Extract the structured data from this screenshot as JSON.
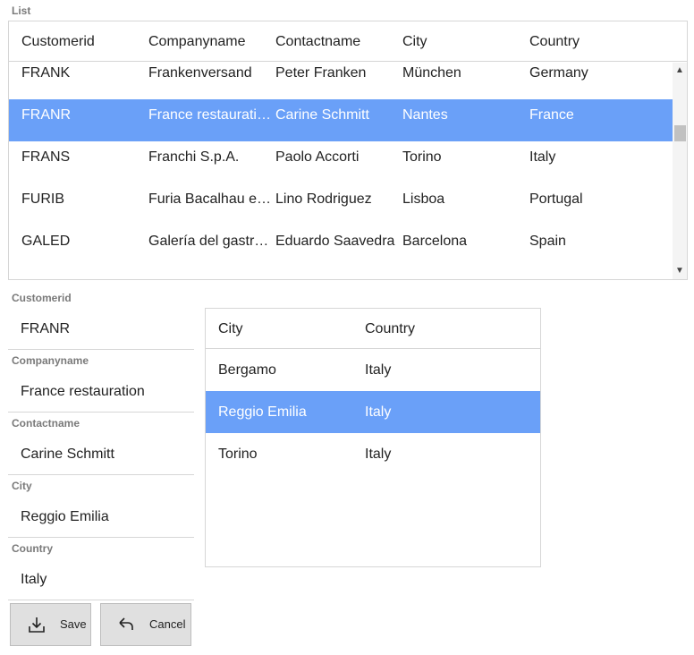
{
  "list": {
    "label": "List",
    "columns": [
      "Customerid",
      "Companyname",
      "Contactname",
      "City",
      "Country"
    ],
    "rows": [
      [
        "FRANK",
        "Frankenversand",
        "Peter Franken",
        "München",
        "Germany"
      ],
      [
        "FRANR",
        "France restauration",
        "Carine Schmitt",
        "Nantes",
        "France"
      ],
      [
        "FRANS",
        "Franchi S.p.A.",
        "Paolo Accorti",
        "Torino",
        "Italy"
      ],
      [
        "FURIB",
        "Furia Bacalhau e Frutos do Mar",
        "Lino Rodriguez",
        "Lisboa",
        "Portugal"
      ],
      [
        "GALED",
        "Galería del gastrónomo",
        "Eduardo Saavedra",
        "Barcelona",
        "Spain"
      ]
    ],
    "selected_index": 1
  },
  "form": {
    "fields": [
      {
        "label": "Customerid",
        "value": "FRANR"
      },
      {
        "label": "Companyname",
        "value": "France restauration"
      },
      {
        "label": "Contactname",
        "value": "Carine Schmitt"
      },
      {
        "label": "City",
        "value": "Reggio Emilia"
      },
      {
        "label": "Country",
        "value": "Italy"
      }
    ]
  },
  "detail": {
    "columns": [
      "City",
      "Country"
    ],
    "rows": [
      [
        "Bergamo",
        "Italy"
      ],
      [
        "Reggio Emilia",
        "Italy"
      ],
      [
        "Torino",
        "Italy"
      ]
    ],
    "selected_index": 1
  },
  "buttons": {
    "save_label": "Save",
    "save_icon": "download-icon",
    "cancel_label": "Cancel",
    "cancel_icon": "undo-icon"
  },
  "colors": {
    "selection": "#6aa0f8",
    "button_bg": "#e0e0e0"
  }
}
